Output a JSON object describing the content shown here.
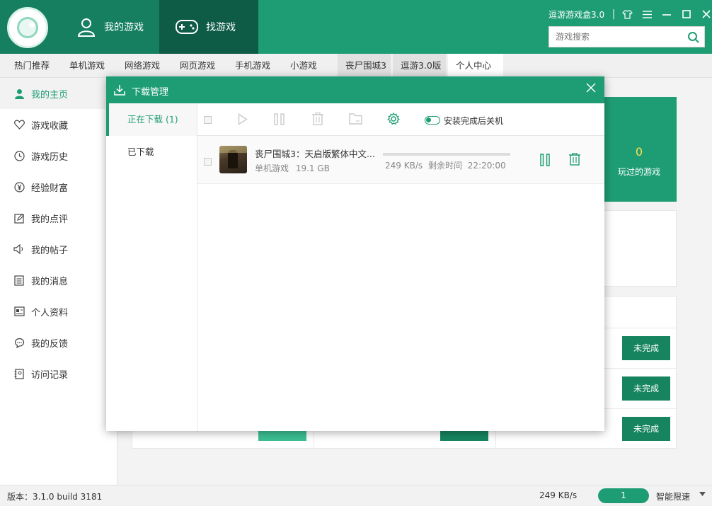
{
  "header": {
    "tabs": [
      {
        "label": "我的游戏",
        "icon": "user-icon"
      },
      {
        "label": "找游戏",
        "icon": "gamepad-icon"
      }
    ],
    "app_title": "逗游游戏盒3.0",
    "search": {
      "placeholder": "游戏搜索",
      "value": ""
    }
  },
  "nav": {
    "items": [
      "热门推荐",
      "单机游戏",
      "网络游戏",
      "网页游戏",
      "手机游戏",
      "小游戏",
      "丧尸围城3",
      "逗游3.0版",
      "个人中心"
    ]
  },
  "sidebar": {
    "items": [
      {
        "label": "我的主页",
        "icon": "user-icon"
      },
      {
        "label": "游戏收藏",
        "icon": "heart-icon"
      },
      {
        "label": "游戏历史",
        "icon": "clock-icon"
      },
      {
        "label": "经验财富",
        "icon": "yen-icon"
      },
      {
        "label": "我的点评",
        "icon": "edit-icon"
      },
      {
        "label": "我的帖子",
        "icon": "megaphone-icon"
      },
      {
        "label": "我的消息",
        "icon": "document-icon"
      },
      {
        "label": "个人资料",
        "icon": "profile-card-icon"
      },
      {
        "label": "我的反馈",
        "icon": "chat-bubble-icon"
      },
      {
        "label": "访问记录",
        "icon": "record-book-icon"
      }
    ]
  },
  "main": {
    "stat": {
      "value": "0",
      "label": "玩过的游戏"
    },
    "tasks": [
      {
        "status": "未完成"
      },
      {
        "status": "未完成"
      },
      {
        "status": "未完成"
      }
    ]
  },
  "dialog": {
    "title": "下载管理",
    "tabs": [
      {
        "label": "正在下载 (1)"
      },
      {
        "label": "已下载"
      }
    ],
    "toggle_label": "安装完成后关机",
    "downloads": [
      {
        "name": "丧尸围城3：天启版繁体中文...",
        "category": "单机游戏",
        "size": "19.1 GB",
        "speed": "249 KB/s",
        "remaining_label": "剩余时间",
        "remaining": "22:20:00",
        "progress": 0
      }
    ]
  },
  "status_bar": {
    "version": "版本：3.1.0 build 3181",
    "speed": "249 KB/s",
    "count": "1",
    "limit": "智能限速"
  }
}
